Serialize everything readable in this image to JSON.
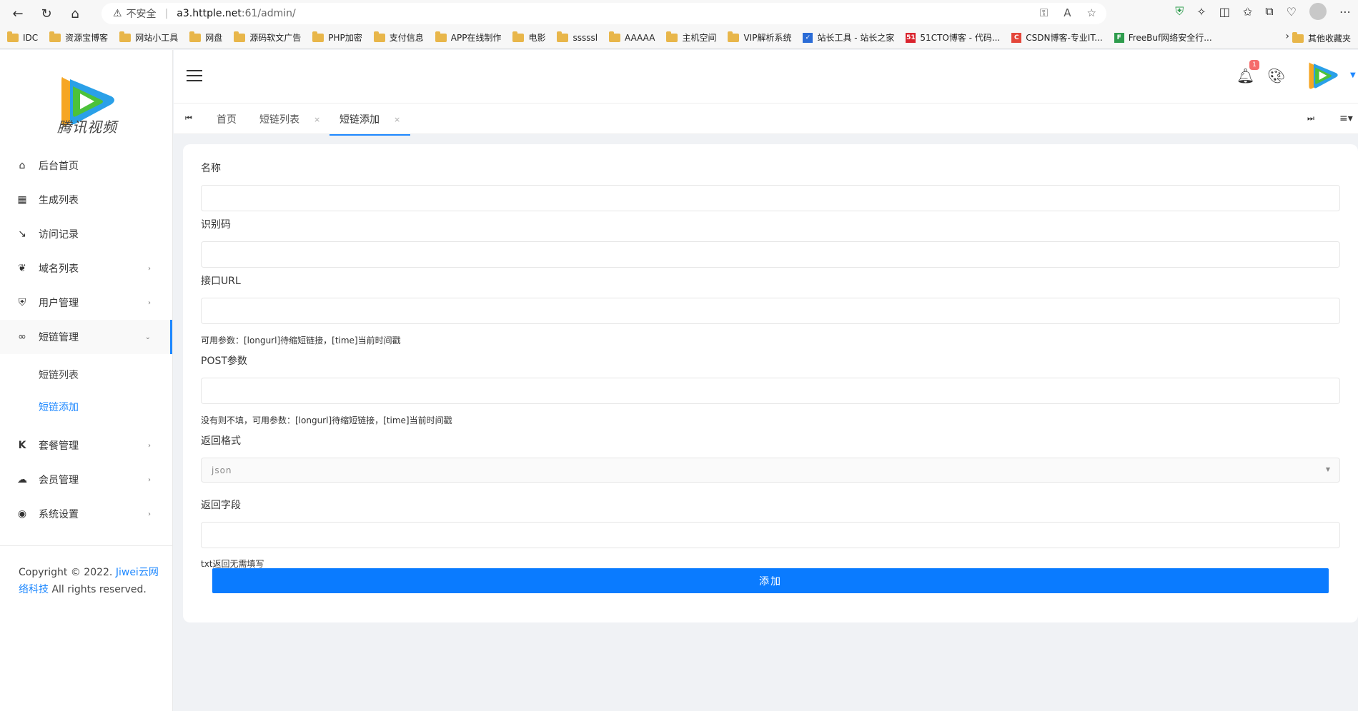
{
  "browser": {
    "security_label": "不安全",
    "url_host": "a3.httple.net",
    "url_path": ":61/admin/",
    "bookmarks": [
      {
        "label": "IDC",
        "type": "folder"
      },
      {
        "label": "资源宝博客",
        "type": "folder"
      },
      {
        "label": "网站小工具",
        "type": "folder"
      },
      {
        "label": "网盘",
        "type": "folder"
      },
      {
        "label": "源码软文广告",
        "type": "folder"
      },
      {
        "label": "PHP加密",
        "type": "folder"
      },
      {
        "label": "支付信息",
        "type": "folder"
      },
      {
        "label": "APP在线制作",
        "type": "folder"
      },
      {
        "label": "电影",
        "type": "folder"
      },
      {
        "label": "sssssl",
        "type": "folder"
      },
      {
        "label": "AAAAA",
        "type": "folder"
      },
      {
        "label": "主机空间",
        "type": "folder"
      },
      {
        "label": "VIP解析系统",
        "type": "folder"
      },
      {
        "label": "站长工具 - 站长之家",
        "type": "site"
      },
      {
        "label": "51CTO博客 - 代码...",
        "type": "site"
      },
      {
        "label": "CSDN博客-专业IT...",
        "type": "site"
      },
      {
        "label": "FreeBuf网络安全行...",
        "type": "site"
      }
    ],
    "other_bookmarks": "其他收藏夹"
  },
  "sidebar": {
    "logo_text": "腾讯视频",
    "items": [
      {
        "label": "后台首页",
        "icon": "dashboard-icon",
        "arrow": ""
      },
      {
        "label": "生成列表",
        "icon": "table-icon",
        "arrow": ""
      },
      {
        "label": "访问记录",
        "icon": "arrow-in-icon",
        "arrow": ""
      },
      {
        "label": "域名列表",
        "icon": "leaf-icon",
        "arrow": "›"
      },
      {
        "label": "用户管理",
        "icon": "shield-user-icon",
        "arrow": "›"
      },
      {
        "label": "短链管理",
        "icon": "link-icon",
        "arrow": "⌄"
      }
    ],
    "submenu": [
      {
        "label": "短链列表"
      },
      {
        "label": "短链添加"
      }
    ],
    "items_after": [
      {
        "label": "套餐管理",
        "icon": "k-icon",
        "arrow": "›"
      },
      {
        "label": "会员管理",
        "icon": "cloud-icon",
        "arrow": "›"
      },
      {
        "label": "系统设置",
        "icon": "globe-icon",
        "arrow": "›"
      }
    ],
    "copyright_prefix": "Copyright © 2022. ",
    "copyright_link": "Jiwei云网络科技",
    "copyright_suffix": " All rights reserved."
  },
  "header": {
    "notification_count": "1"
  },
  "tabs": [
    {
      "label": "首页",
      "closable": false
    },
    {
      "label": "短链列表",
      "closable": true
    },
    {
      "label": "短链添加",
      "closable": true,
      "active": true
    }
  ],
  "form": {
    "name_label": "名称",
    "code_label": "识别码",
    "api_label": "接口URL",
    "api_help": "可用参数：[longurl]待缩短链接，[time]当前时间戳",
    "post_label": "POST参数",
    "post_help": "没有则不填，可用参数：[longurl]待缩短链接，[time]当前时间戳",
    "format_label": "返回格式",
    "format_value": "json",
    "field_label": "返回字段",
    "field_help": "txt返回无需填写",
    "submit_label": "添加"
  },
  "colors": {
    "accent": "#1e88ff",
    "button": "#0a7bff",
    "badge": "#f56c6c"
  }
}
